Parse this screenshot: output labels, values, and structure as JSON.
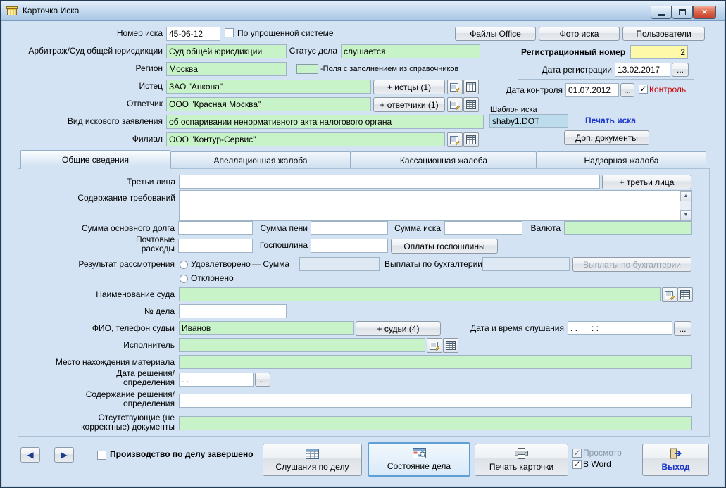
{
  "window": {
    "title": "Карточка Иска"
  },
  "icons": {
    "check": "✓",
    "close": "×",
    "nav_left": "◀",
    "nav_right": "▶",
    "scroll_up": "▲",
    "scroll_down": "▼",
    "ellipsis": "..."
  },
  "colors": {
    "reference_field": "#c8f3c8",
    "reg_number_field": "#fdf9a8",
    "control_label": "#cc0000",
    "action_link": "#1a35cc",
    "window_bg": "#d3e3f3"
  },
  "header": {
    "case_number_label": "Номер иска",
    "case_number": "45-06-12",
    "simplified_label": "По упрощенной системе",
    "files_office_button": "Файлы Office",
    "photo_button": "Фото иска",
    "users_button": "Пользователи",
    "court_label": "Арбитраж/Суд общей юрисдикции",
    "court": "Суд общей юрисдикции",
    "status_label": "Статус дела",
    "status": "слушается",
    "reg_number_label": "Регистрационный номер",
    "reg_number": "2",
    "region_label": "Регион",
    "region": "Москва",
    "legend": "-Поля с заполнением из справочников",
    "reg_date_label": "Дата регистрации",
    "reg_date": "13.02.2017",
    "plaintiff_label": "Истец",
    "plaintiff": "ЗАО \"Анкона\"",
    "plaintiffs_button": "+ истцы (1)",
    "control_date_label": "Дата контроля",
    "control_date": "01.07.2012",
    "control_label": "Контроль",
    "defendant_label": "Ответчик",
    "defendant": "ООО \"Красная Москва\"",
    "defendants_button": "+ ответчики (1)",
    "claim_template_label": "Шаблон иска",
    "claim_type_label": "Вид искового заявления",
    "claim_type": "об оспаривании ненормативного акта налогового органа",
    "claim_template": "shaby1.DOT",
    "print_claim": "Печать иска",
    "branch_label": "Филиал",
    "branch": "ООО \"Контур-Сервис\"",
    "extra_docs_button": "Доп. документы"
  },
  "tabs": [
    {
      "label": "Общие сведения"
    },
    {
      "label": "Апелляционная жалоба"
    },
    {
      "label": "Кассационная жалоба"
    },
    {
      "label": "Надзорная жалоба"
    }
  ],
  "general": {
    "third_parties_label": "Третьи лица",
    "third_parties_button": "+ третьи лица",
    "claims_label": "Содержание требований",
    "main_debt_label": "Сумма основного долга",
    "penalty_label": "Сумма пени",
    "claim_sum_label": "Сумма иска",
    "currency_label": "Валюта",
    "postal_label": "Почтовые\nрасходы",
    "duty_label": "Госпошлина",
    "duty_payments_button": "Оплаты госпошлины",
    "result_label": "Результат рассмотрения",
    "satisfied_label": "Удовлетворено",
    "sum_label": "— Сумма",
    "accounting_label": "Выплаты по бухгалтерии",
    "accounting_button": "Выплаты по бухгалтерии",
    "rejected_label": "Отклонено",
    "court_name_label": "Наименование суда",
    "case_no_label": "№ дела",
    "judge_label": "ФИО, телефон судьи",
    "judge": "Иванов",
    "judges_button": "+ судьи (4)",
    "hearing_label": "Дата и время слушания",
    "hearing_value": ". .      : :",
    "executor_label": "Исполнитель",
    "material_label": "Место нахождения материала",
    "decision_date_label": "Дата решения/\nопределения",
    "decision_date_value": ". .",
    "decision_content_label": "Содержание решения/\nопределения",
    "missing_docs_label": "Отсутствующие (не\nкорректные) документы"
  },
  "footer": {
    "completed_label": "Производство по делу завершено",
    "hearings_button": "Слушания по делу",
    "state_button": "Состояние дела",
    "print_button": "Печать карточки",
    "preview_label": "Просмотр",
    "word_label": "В Word",
    "exit_button": "Выход"
  }
}
